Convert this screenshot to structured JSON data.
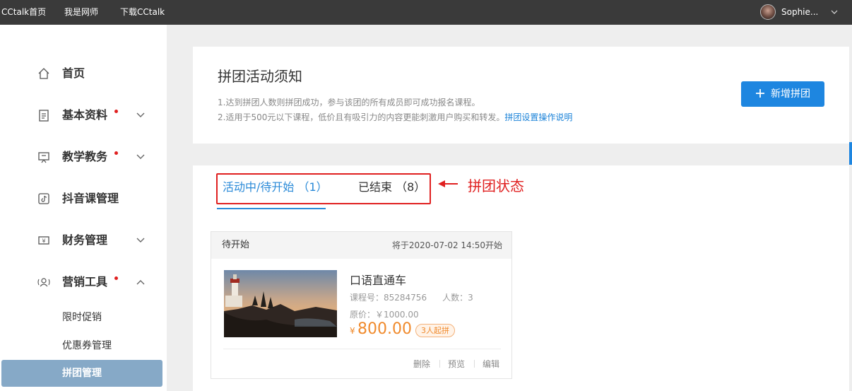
{
  "topbar": {
    "links": [
      "CCtalk首页",
      "我是网师",
      "下载CCtalk"
    ],
    "user_name": "Sophie..."
  },
  "sidebar": {
    "items": [
      {
        "label": "首页",
        "icon": "home-icon",
        "has_dot": false,
        "chevron": "none"
      },
      {
        "label": "基本资料",
        "icon": "profile-doc-icon",
        "has_dot": true,
        "chevron": "down"
      },
      {
        "label": "教学教务",
        "icon": "teaching-board-icon",
        "has_dot": true,
        "chevron": "down"
      },
      {
        "label": "抖音课管理",
        "icon": "tiktok-icon",
        "has_dot": false,
        "chevron": "none"
      },
      {
        "label": "财务管理",
        "icon": "finance-yen-icon",
        "has_dot": false,
        "chevron": "down"
      },
      {
        "label": "营销工具",
        "icon": "marketing-user-icon",
        "has_dot": true,
        "chevron": "up"
      }
    ],
    "sub_items": [
      {
        "label": "限时促销",
        "active": false
      },
      {
        "label": "优惠券管理",
        "active": false
      },
      {
        "label": "拼团管理",
        "active": true
      }
    ]
  },
  "notice": {
    "title": "拼团活动须知",
    "line1": "1.达到拼团人数则拼团成功，参与该团的所有成员即可成功报名课程。",
    "line2_text": "2.适用于500元以下课程，低价且有吸引力的内容更能刺激用户购买和转发。",
    "line2_link": "拼团设置操作说明",
    "add_button": "新增拼团"
  },
  "tabs": [
    {
      "label": "活动中/待开始 （1）",
      "active": true
    },
    {
      "label": "已结束 （8）",
      "active": false
    }
  ],
  "annotation": "拼团状态",
  "group_card": {
    "status": "待开始",
    "start_time": "将于2020-07-02 14:50开始",
    "course_name": "口语直通车",
    "course_id_label": "课程号：85284756",
    "members_label": "人数：3",
    "original_price": "原价：￥1000.00",
    "currency": "¥",
    "price": "800.00",
    "badge": "3人起拼",
    "actions": [
      "删除",
      "预览",
      "编辑"
    ]
  },
  "colors": {
    "accent_blue": "#1e86e0",
    "sidebar_active": "#86a9c7",
    "annotation_red": "#e02020",
    "price_orange": "#f08a2c",
    "topbar": "#3a3a3a"
  }
}
